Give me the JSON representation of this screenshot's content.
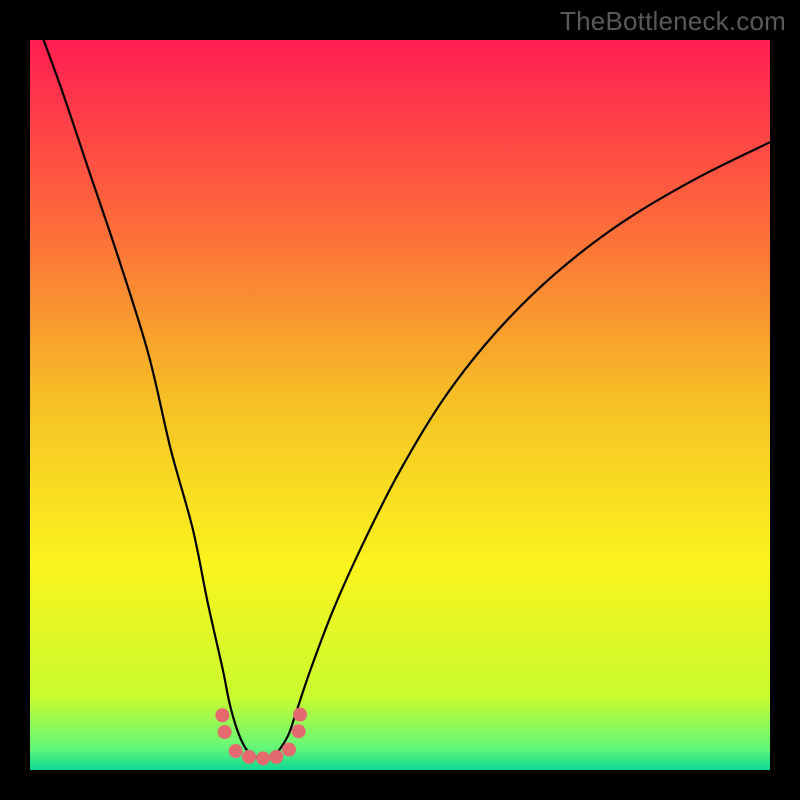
{
  "watermark": "TheBottleneck.com",
  "chart_data": {
    "type": "line",
    "title": "",
    "xlabel": "",
    "ylabel": "",
    "xlim": [
      0,
      100
    ],
    "ylim": [
      0,
      100
    ],
    "grid": false,
    "legend": false,
    "background_gradient": {
      "stops": [
        {
          "offset": 0.0,
          "color": "#ff1e52"
        },
        {
          "offset": 0.25,
          "color": "#fd6a3a"
        },
        {
          "offset": 0.5,
          "color": "#f6c225"
        },
        {
          "offset": 0.72,
          "color": "#fbf41e"
        },
        {
          "offset": 0.9,
          "color": "#c8fb2e"
        },
        {
          "offset": 0.97,
          "color": "#63f77a"
        },
        {
          "offset": 1.0,
          "color": "#0fd893"
        }
      ]
    },
    "series": [
      {
        "name": "bottleneck-curve",
        "stroke": "#000000",
        "stroke_width": 2.2,
        "x": [
          0,
          4,
          8,
          12,
          16,
          19,
          22,
          24,
          26,
          27,
          28,
          29,
          30,
          31,
          32,
          33,
          34,
          35,
          36,
          38,
          41,
          45,
          50,
          56,
          63,
          71,
          80,
          90,
          100
        ],
        "y": [
          105,
          94,
          82,
          70,
          57,
          44,
          33,
          23,
          14,
          9,
          5.5,
          3.2,
          2.0,
          1.6,
          1.6,
          2.0,
          3.2,
          5.0,
          8.0,
          14,
          22,
          31,
          41,
          51,
          60,
          68,
          75,
          81,
          86
        ]
      }
    ],
    "markers": {
      "name": "valley-dots",
      "fill": "#e46a6f",
      "radius": 7,
      "points": [
        {
          "x": 26.0,
          "y": 7.5
        },
        {
          "x": 26.3,
          "y": 5.2
        },
        {
          "x": 27.8,
          "y": 2.6
        },
        {
          "x": 29.6,
          "y": 1.8
        },
        {
          "x": 31.5,
          "y": 1.6
        },
        {
          "x": 33.3,
          "y": 1.8
        },
        {
          "x": 35.0,
          "y": 2.8
        },
        {
          "x": 36.3,
          "y": 5.3
        },
        {
          "x": 36.5,
          "y": 7.6
        }
      ]
    }
  }
}
